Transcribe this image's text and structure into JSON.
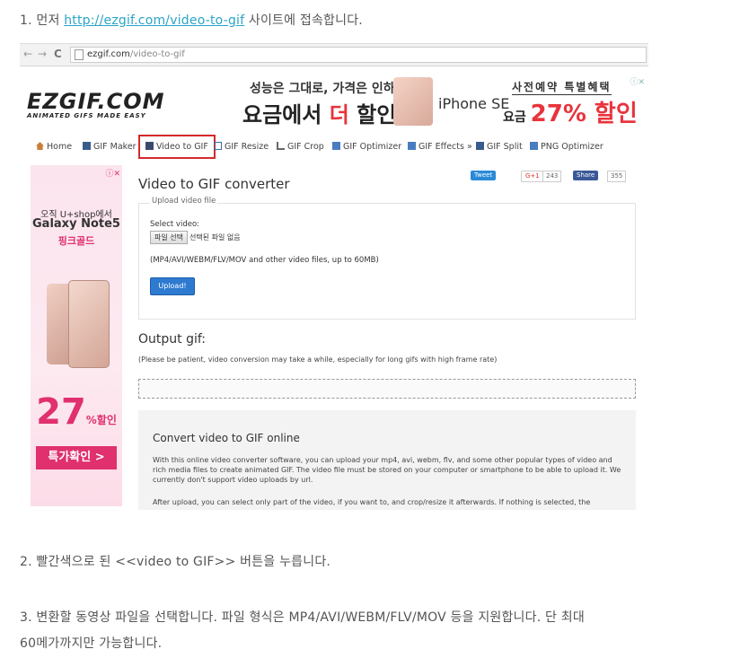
{
  "steps": {
    "s1_prefix": "1. 먼저 ",
    "s1_link": "http://ezgif.com/video-to-gif",
    "s1_suffix": " 사이트에 접속합니다.",
    "s2": "2. 빨간색으로 된 <<video to GIF>> 버튼을 누릅니다.",
    "s3_line1": "3. 변환할 동영상 파일을 선택합니다. 파일 형식은 MP4/AVI/WEBM/FLV/MOV 등을 지원합니다. 단 최대",
    "s3_line2": "60메가까지만 가능합니다."
  },
  "browser": {
    "back": "←",
    "forward": "→",
    "reload": "C",
    "domain": "ezgif.com",
    "path": "/video-to-gif"
  },
  "logo": {
    "title": "EZGIF.COM",
    "tagline": "ANIMATED GIFS MADE EASY"
  },
  "banner": {
    "line1": "성능은 그대로, 가격은 인하!",
    "line2a": "요금에서 ",
    "line2b": "더",
    "line2c": " 할인!",
    "iphone": "iPhone SE",
    "right1": "사전예약 특별혜택",
    "right2a": "요금 ",
    "right2b": "27",
    "right2c": "% 할인",
    "adx": "ⓘ✕"
  },
  "nav": {
    "items": [
      "Home",
      "GIF Maker",
      "Video to GIF",
      "GIF Resize",
      "GIF Crop",
      "GIF Optimizer",
      "GIF Effects »",
      "GIF Split",
      "PNG Optimizer"
    ]
  },
  "sidebar_ad": {
    "adx": "ⓘ✕",
    "l1": "오직 U+shop에서",
    "l2": "Galaxy Note5",
    "l3": "핑크골드",
    "pct": "27",
    "pct_suffix": "%할인",
    "button": "특가확인 >"
  },
  "main": {
    "title": "Video to GIF converter",
    "tweet": "Tweet",
    "gplus": "G+1",
    "gplus_count": "243",
    "share": "Share",
    "share_count": "355",
    "upload_legend": "Upload video file",
    "select_label": "Select video:",
    "file_button": "파일 선택",
    "file_status": "선택된 파일 없음",
    "hint": "(MP4/AVI/WEBM/FLV/MOV and other video files, up to 60MB)",
    "upload_button": "Upload!",
    "output_heading": "Output gif:",
    "patience": "(Please be patient, video conversion may take a while, especially for long gifs with high frame rate)",
    "info_heading": "Convert video to GIF online",
    "info_text": "With this online video converter software, you can upload your mp4, avi, webm, flv, and some other popular types of video and rich media files to create animated GIF. The video file must be stored on your computer or smartphone to be able to upload it. We currently don't support video uploads by url.",
    "info_text2": "After upload, you can select only part of the video, if you want to, and crop/resize it afterwards. If nothing is selected, the"
  },
  "colors": {
    "link": "#2aa4c8",
    "highlight_border": "#d42a2a",
    "upload_button": "#2e7ad0",
    "ad_pink": "#e0306e"
  }
}
